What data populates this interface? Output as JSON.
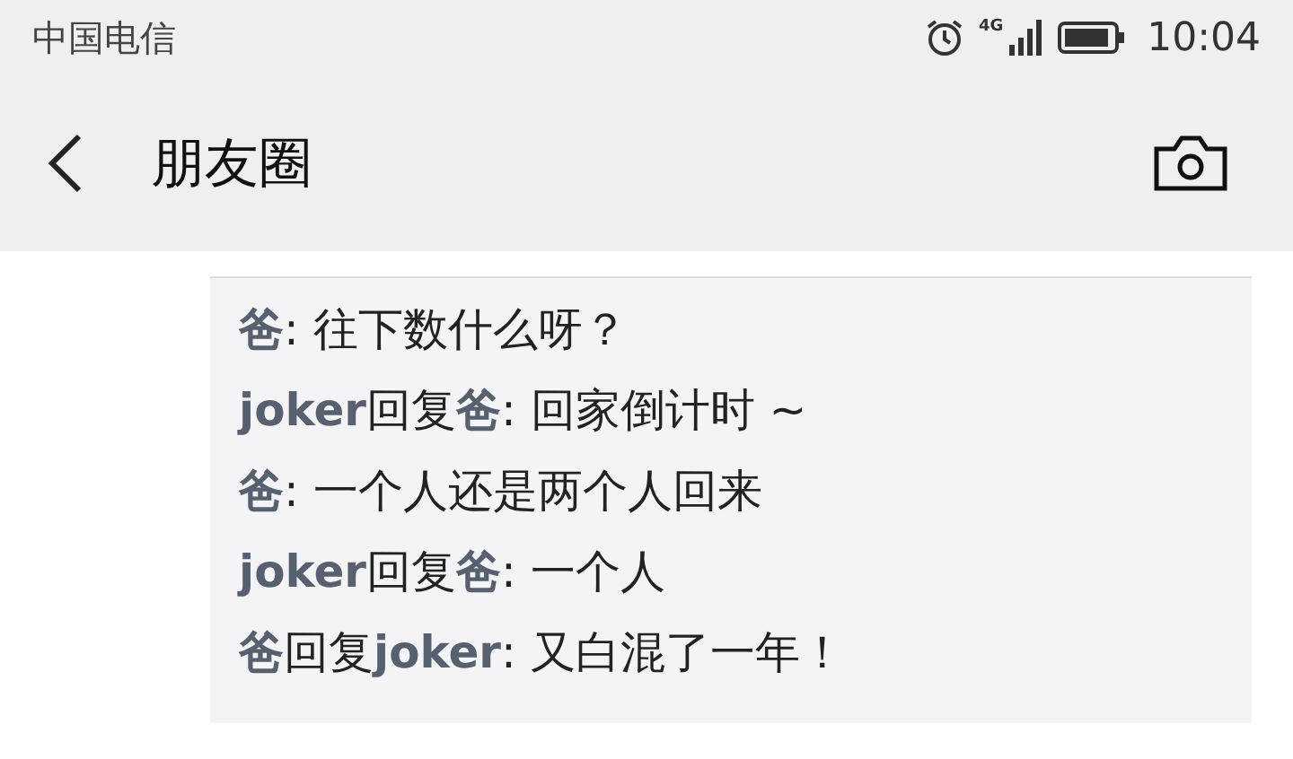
{
  "status_bar": {
    "carrier": "中国电信",
    "network": "4G",
    "time": "10:04"
  },
  "header": {
    "title": "朋友圈"
  },
  "comments": [
    {
      "author": "爸",
      "text": ": 往下数什么呀？"
    },
    {
      "author": "joker",
      "reply_label": "回复",
      "reply_to": "爸",
      "text": ": 回家倒计时 ~"
    },
    {
      "author": "爸",
      "text": ": 一个人还是两个人回来"
    },
    {
      "author": "joker",
      "reply_label": "回复",
      "reply_to": "爸",
      "text": ": 一个人"
    },
    {
      "author": "爸",
      "reply_label": "回复",
      "reply_to": "joker",
      "text": ": 又白混了一年！"
    }
  ]
}
